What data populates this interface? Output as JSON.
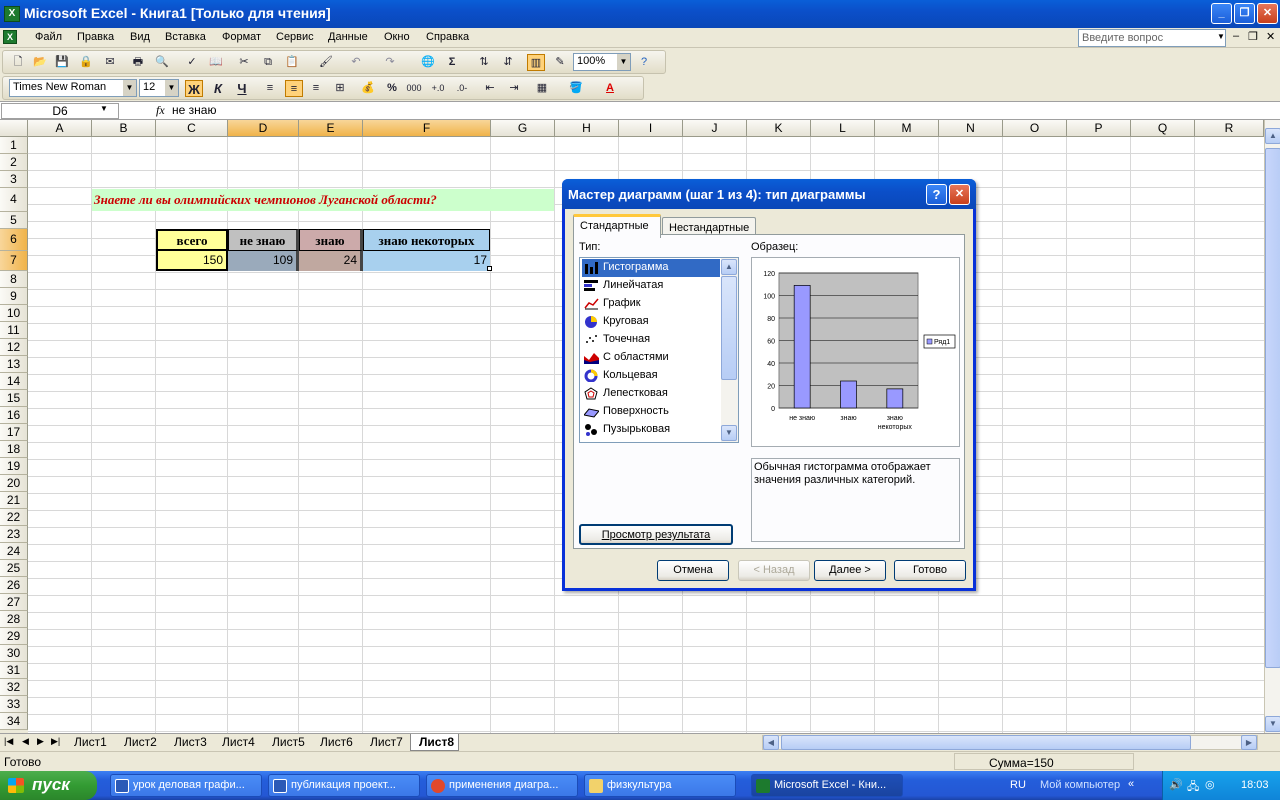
{
  "window": {
    "title": "Microsoft Excel - Книга1  [Только для чтения]",
    "app_icon": "excel-icon"
  },
  "menu": {
    "items": [
      "Файл",
      "Правка",
      "Вид",
      "Вставка",
      "Формат",
      "Сервис",
      "Данные",
      "Окно",
      "Справка"
    ],
    "help_placeholder": "Введите вопрос"
  },
  "toolbar": {
    "zoom": "100%",
    "font": "Times New Roman",
    "font_size": "12",
    "bold": "Ж",
    "italic": "К",
    "underline": "Ч",
    "percent": "%",
    "thousands": "000",
    "sigma": "Σ"
  },
  "formula_bar": {
    "name_box": "D6",
    "fx": "fx",
    "content": "не знаю"
  },
  "columns": [
    "A",
    "B",
    "C",
    "D",
    "E",
    "F",
    "G",
    "H",
    "I",
    "J",
    "K",
    "L",
    "M",
    "N",
    "O",
    "P",
    "Q",
    "R"
  ],
  "rows": [
    "1",
    "2",
    "3",
    "4",
    "5",
    "6",
    "7",
    "8",
    "9",
    "10",
    "11",
    "12",
    "13",
    "14",
    "15",
    "16",
    "17",
    "18",
    "19",
    "20",
    "21",
    "22",
    "23",
    "24",
    "25",
    "26",
    "27",
    "28",
    "29",
    "30",
    "31",
    "32",
    "33",
    "34"
  ],
  "sheet": {
    "question": "Знаете ли вы олимпийских чемпионов Луганской области?",
    "headers": [
      "всего",
      "не знаю",
      "знаю",
      "знаю некоторых"
    ],
    "values": [
      "150",
      "109",
      "24",
      "17"
    ]
  },
  "sheet_tabs": [
    "Лист1",
    "Лист2",
    "Лист3",
    "Лист4",
    "Лист5",
    "Лист6",
    "Лист7",
    "Лист8"
  ],
  "status": {
    "left": "Готово",
    "sum": "Сумма=150"
  },
  "dialog": {
    "title": "Мастер диаграмм (шаг 1 из 4): тип диаграммы",
    "help": "?",
    "tabs": [
      "Стандартные",
      "Нестандартные"
    ],
    "type_label": "Тип:",
    "sample_label": "Образец:",
    "types": [
      "Гистограмма",
      "Линейчатая",
      "График",
      "Круговая",
      "Точечная",
      "С областями",
      "Кольцевая",
      "Лепестковая",
      "Поверхность",
      "Пузырьковая"
    ],
    "description": "Обычная гистограмма отображает значения различных категорий.",
    "preview_button": "Просмотр результата",
    "buttons": {
      "cancel": "Отмена",
      "back": "< Назад",
      "next": "Далее >",
      "finish": "Готово"
    }
  },
  "chart_data": {
    "type": "bar",
    "categories": [
      "не знаю",
      "знаю",
      "знаю некоторых"
    ],
    "series": [
      {
        "name": "Ряд1",
        "values": [
          109,
          24,
          17
        ]
      }
    ],
    "ylim": [
      0,
      120
    ],
    "yticks": [
      "0",
      "20",
      "40",
      "60",
      "80",
      "100",
      "120"
    ],
    "grid": true,
    "legend": "right",
    "bar_color": "#9999ff",
    "plot_bg": "#c0c0c0"
  },
  "taskbar": {
    "start": "пуск",
    "tasks": [
      "урок деловая графи...",
      "публикация проект...",
      "применения диагра...",
      "физкультура",
      "Microsoft Excel - Кни..."
    ],
    "lang": "RU",
    "my_computer": "Мой компьютер",
    "clock": "18:03"
  }
}
